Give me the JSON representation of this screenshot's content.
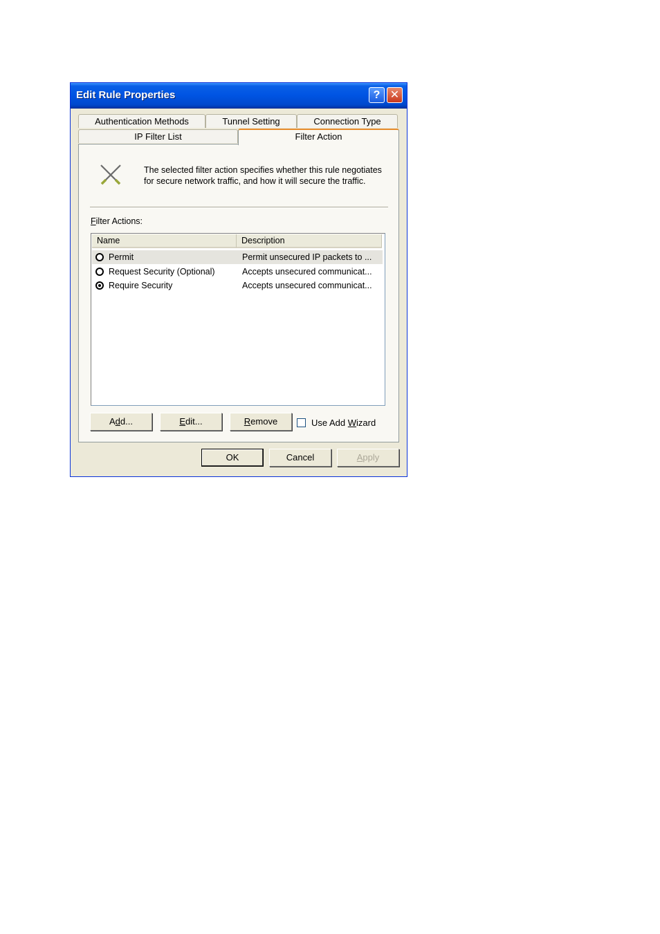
{
  "window": {
    "title": "Edit Rule Properties",
    "help_glyph": "?",
    "close_glyph": "✕"
  },
  "tabs": {
    "row1": [
      {
        "label": "Authentication Methods"
      },
      {
        "label": "Tunnel Setting"
      },
      {
        "label": "Connection Type"
      }
    ],
    "row2": [
      {
        "label": "IP Filter List"
      },
      {
        "label": "Filter Action",
        "active": true
      }
    ]
  },
  "info": {
    "icon": "crossed-tools-icon",
    "line1": "The selected filter action specifies whether this rule negotiates",
    "line2": "for secure network traffic, and how it will secure the traffic."
  },
  "filter_actions": {
    "label_accel": "F",
    "label_rest": "ilter Actions:",
    "columns": [
      "Name",
      "Description"
    ],
    "rows": [
      {
        "name": "Permit",
        "description": "Permit unsecured IP packets to ...",
        "checked": false
      },
      {
        "name": "Request Security (Optional)",
        "description": "Accepts unsecured communicat...",
        "checked": false
      },
      {
        "name": "Require Security",
        "description": "Accepts unsecured communicat...",
        "checked": true
      }
    ]
  },
  "actions": {
    "add": {
      "pre": "A",
      "accel": "d",
      "post": "d..."
    },
    "edit": {
      "pre": "",
      "accel": "E",
      "post": "dit..."
    },
    "remove": {
      "pre": "",
      "accel": "R",
      "post": "emove"
    },
    "wizard": {
      "pre": "Use Add ",
      "accel": "W",
      "post": "izard",
      "checked": false
    }
  },
  "footer": {
    "ok": "OK",
    "cancel": "Cancel",
    "apply_accel": "A",
    "apply_rest": "pply"
  }
}
